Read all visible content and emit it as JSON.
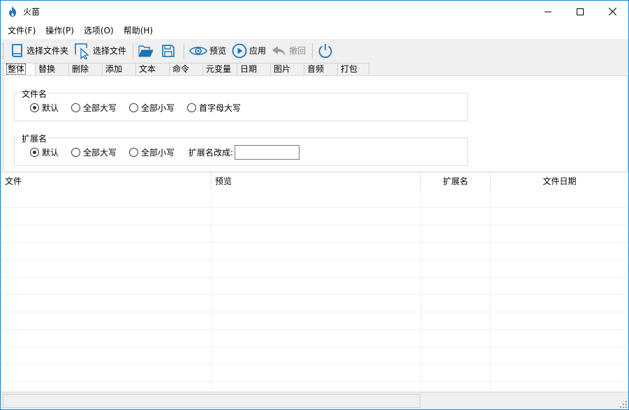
{
  "window": {
    "title": "火苗"
  },
  "menu": [
    "文件(F)",
    "操作(P)",
    "选项(O)",
    "帮助(H)"
  ],
  "toolbar": {
    "select_folder": "选择文件夹",
    "select_file": "选择文件",
    "preview": "预览",
    "apply": "应用",
    "undo": "撤回"
  },
  "tabs": [
    "整体",
    "替换",
    "删除",
    "添加",
    "文本",
    "命令",
    "元变量",
    "日期",
    "图片",
    "音频",
    "打包"
  ],
  "filename_group": {
    "legend": "文件名",
    "options": [
      "默认",
      "全部大写",
      "全部小写",
      "首字母大写"
    ],
    "selected": 0
  },
  "ext_group": {
    "legend": "扩展名",
    "options": [
      "默认",
      "全部大写",
      "全部小写"
    ],
    "selected": 0,
    "change_label": "扩展名改成:",
    "change_value": ""
  },
  "list": {
    "columns": [
      "文件",
      "预览",
      "扩展名",
      "文件日期"
    ]
  },
  "colors": {
    "accent": "#1883d7",
    "icon_blue": "#1a73b8"
  }
}
